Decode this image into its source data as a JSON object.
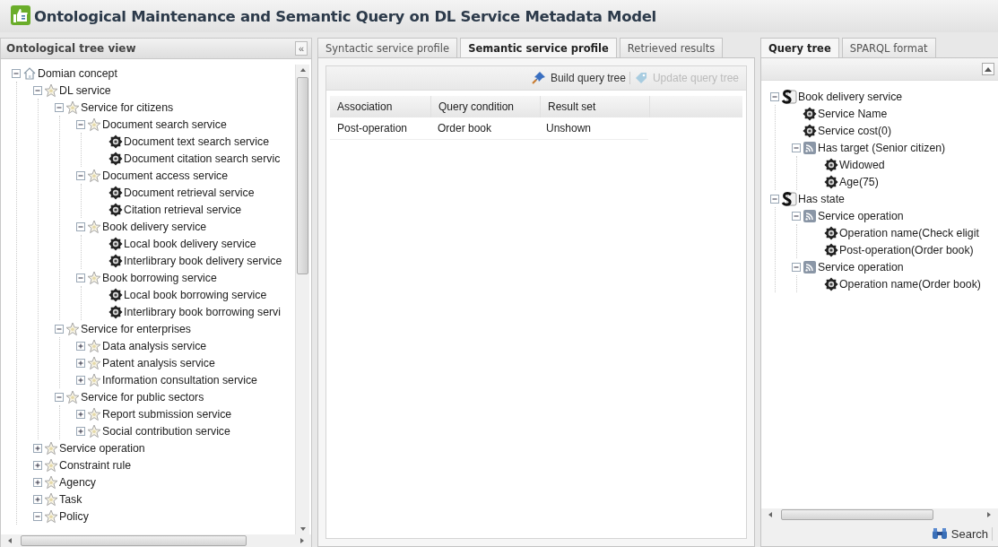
{
  "window": {
    "title": "Ontological Maintenance and Semantic Query on DL Service Metadata Model"
  },
  "left_panel": {
    "title": "Ontological tree view",
    "collapse_button": "«",
    "tree": [
      {
        "label": "Domian concept",
        "kind": "home",
        "expanded": true,
        "children": [
          {
            "label": "DL service",
            "kind": "star",
            "expanded": true,
            "children": [
              {
                "label": "Service for citizens",
                "kind": "star",
                "expanded": true,
                "children": [
                  {
                    "label": "Document search service",
                    "kind": "star",
                    "expanded": true,
                    "children": [
                      {
                        "label": "Document text search service",
                        "kind": "gear"
                      },
                      {
                        "label": "Document citation search servic",
                        "kind": "gear"
                      }
                    ]
                  },
                  {
                    "label": "Document access service",
                    "kind": "star",
                    "expanded": true,
                    "children": [
                      {
                        "label": "Document retrieval service",
                        "kind": "gear"
                      },
                      {
                        "label": "Citation retrieval service",
                        "kind": "gear"
                      }
                    ]
                  },
                  {
                    "label": "Book delivery service",
                    "kind": "star",
                    "expanded": true,
                    "children": [
                      {
                        "label": "Local book delivery service",
                        "kind": "gear"
                      },
                      {
                        "label": "Interlibrary book delivery service",
                        "kind": "gear"
                      }
                    ]
                  },
                  {
                    "label": "Book borrowing service",
                    "kind": "star",
                    "expanded": true,
                    "children": [
                      {
                        "label": "Local book borrowing service",
                        "kind": "gear"
                      },
                      {
                        "label": "Interlibrary book borrowing servi",
                        "kind": "gear"
                      }
                    ]
                  }
                ]
              },
              {
                "label": "Service for enterprises",
                "kind": "star",
                "expanded": true,
                "children": [
                  {
                    "label": "Data analysis service",
                    "kind": "star",
                    "expanded": false
                  },
                  {
                    "label": "Patent analysis service",
                    "kind": "star",
                    "expanded": false
                  },
                  {
                    "label": "Information consultation service",
                    "kind": "star",
                    "expanded": false
                  }
                ]
              },
              {
                "label": "Service for public sectors",
                "kind": "star",
                "expanded": true,
                "children": [
                  {
                    "label": "Report submission service",
                    "kind": "star",
                    "expanded": false
                  },
                  {
                    "label": "Social contribution service",
                    "kind": "star",
                    "expanded": false
                  }
                ]
              }
            ]
          },
          {
            "label": "Service operation",
            "kind": "star",
            "expanded": false
          },
          {
            "label": "Constraint rule",
            "kind": "star",
            "expanded": false
          },
          {
            "label": "Agency",
            "kind": "star",
            "expanded": false
          },
          {
            "label": "Task",
            "kind": "star",
            "expanded": false
          },
          {
            "label": "Policy",
            "kind": "star",
            "expanded": true
          }
        ]
      }
    ]
  },
  "center_panel": {
    "tabs": [
      {
        "label": "Syntactic service profile",
        "selected": false
      },
      {
        "label": "Semantic service profile",
        "selected": true
      },
      {
        "label": "Retrieved results",
        "selected": false
      }
    ],
    "toolbar": [
      {
        "label": "Build query tree",
        "disabled": false
      },
      {
        "label": "Update query tree",
        "disabled": true
      }
    ],
    "table": {
      "columns": [
        "Association",
        "Query condition",
        "Result set"
      ],
      "rows": [
        [
          "Post-operation",
          "Order book",
          "Unshown"
        ]
      ]
    }
  },
  "right_panel": {
    "tabs": [
      {
        "label": "Query tree",
        "selected": true
      },
      {
        "label": "SPARQL format",
        "selected": false
      }
    ],
    "tree": [
      {
        "label": "Book delivery service",
        "kind": "service",
        "expanded": true,
        "children": [
          {
            "label": "Service Name",
            "kind": "gear"
          },
          {
            "label": "Service cost(0)",
            "kind": "gear"
          },
          {
            "label": "Has target (Senior citizen)",
            "kind": "feed",
            "expanded": true,
            "children": [
              {
                "label": "Widowed",
                "kind": "gear"
              },
              {
                "label": "Age(75)",
                "kind": "gear"
              }
            ]
          }
        ]
      },
      {
        "label": "Has state",
        "kind": "service",
        "expanded": true,
        "children": [
          {
            "label": "Service operation",
            "kind": "feed",
            "expanded": true,
            "children": [
              {
                "label": "Operation name(Check eligit",
                "kind": "gear"
              },
              {
                "label": "Post-operation(Order book)",
                "kind": "gear"
              }
            ]
          },
          {
            "label": "Service operation",
            "kind": "feed",
            "expanded": true,
            "children": [
              {
                "label": "Operation name(Order book)",
                "kind": "gear"
              }
            ]
          }
        ]
      }
    ],
    "search_button": "Search"
  }
}
